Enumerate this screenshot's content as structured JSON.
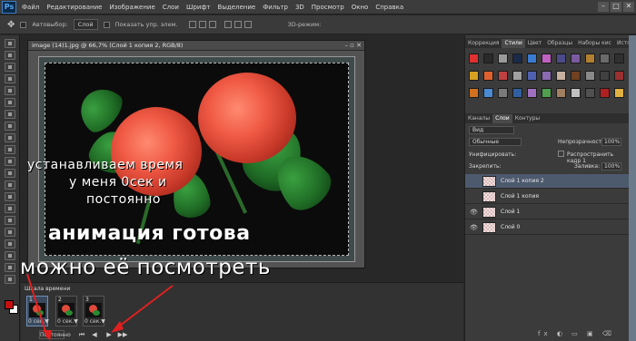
{
  "menubar": {
    "logo": "Ps",
    "items": [
      "Файл",
      "Редактирование",
      "Изображение",
      "Слои",
      "Шрифт",
      "Выделение",
      "Фильтр",
      "3D",
      "Просмотр",
      "Окно",
      "Справка"
    ],
    "window_buttons": [
      "–",
      "□",
      "✕"
    ]
  },
  "options": {
    "autoselect_label": "Автовыбор:",
    "autoselect_value": "Слой",
    "show_controls_label": "Показать упр. элем.",
    "mode_3d_label": "3D-режим:"
  },
  "document": {
    "title": "image (14)1.jpg @ 66,7% (Слой 1 копия 2, RGB/8)",
    "controls": "– ▫ ✕"
  },
  "overlay": {
    "line1": "устанавливаем время",
    "line2": "у меня 0сек и",
    "line3": "постоянно",
    "line4": "анимация готова",
    "line5": "можно её посмотреть"
  },
  "styles_panel": {
    "tabs": [
      "Коррекция",
      "Стили",
      "Цвет",
      "Образцы",
      "Наборы кис",
      "История"
    ],
    "active_tab": "Стили",
    "swatch_colors": [
      "#e03030",
      "#2a2a2a",
      "#9a9a9a",
      "#1a2a4a",
      "#3a7ad0",
      "#c060c0",
      "#4a4a8a",
      "#7a5aa0",
      "#b08030",
      "#6a6a6a",
      "#303030",
      "#d8a020",
      "#e06030",
      "#c04040",
      "#a0a0a0",
      "#5060b0",
      "#8a6ab0",
      "#c8b0a0",
      "#704020",
      "#8a8a8a",
      "#404040",
      "#9a3030",
      "#d07020",
      "#4a8ad0",
      "#7a7a7a",
      "#3060a0",
      "#a070c0",
      "#50a050",
      "#a08060",
      "#c0c0c0",
      "#505050",
      "#b02020",
      "#e0b040"
    ]
  },
  "layers_panel": {
    "tabs": [
      "Каналы",
      "Слои",
      "Контуры"
    ],
    "active_tab": "Слои",
    "filter_label": "Вид",
    "blend_mode": "Обычные",
    "opacity_label": "Непрозрачность:",
    "opacity_value": "100%",
    "unify_label": "Унифицировать:",
    "propagate_label": "Распространить кадр 1",
    "lock_label": "Закрепить:",
    "fill_label": "Заливка:",
    "fill_value": "100%",
    "layers": [
      {
        "name": "Слой 1 копия 2",
        "visible": false,
        "selected": true
      },
      {
        "name": "Слой 1 копия",
        "visible": false,
        "selected": false
      },
      {
        "name": "Слой 1",
        "visible": true,
        "selected": false
      },
      {
        "name": "Слой 0",
        "visible": true,
        "selected": false
      }
    ]
  },
  "timeline": {
    "title": "Шкала времени",
    "frames": [
      {
        "number": "1",
        "delay": "0 сек.▼"
      },
      {
        "number": "2",
        "delay": "0 сек.▼"
      },
      {
        "number": "3",
        "delay": "0 сек.▼"
      }
    ],
    "loop_label": "Постоянно",
    "controls": [
      "⏮",
      "◀",
      "▶",
      "▶▶"
    ]
  }
}
